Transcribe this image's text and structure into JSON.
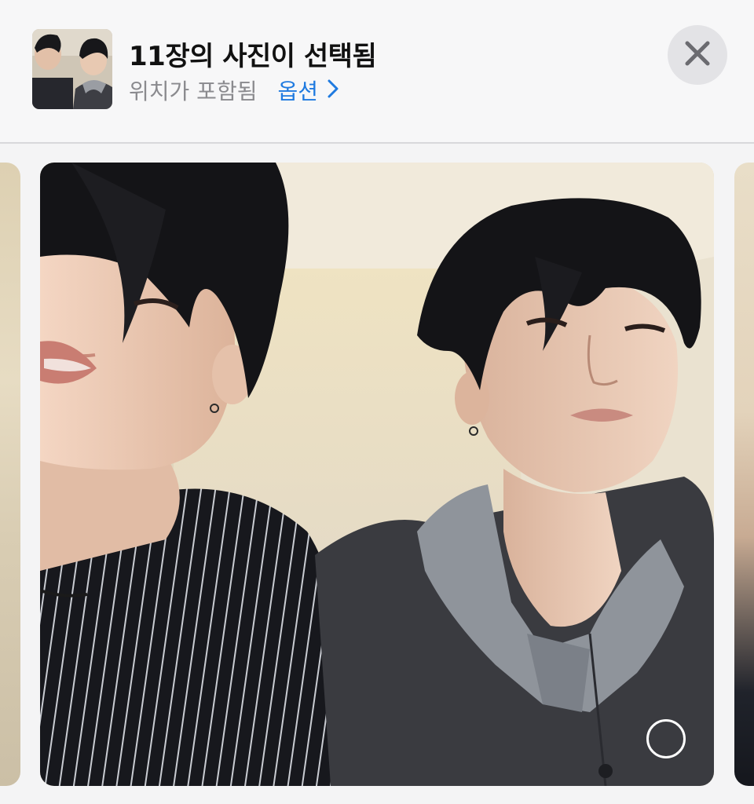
{
  "header": {
    "title": "11장의 사진이 선택됨",
    "subtitle": "위치가 포함됨",
    "options_label": "옵션",
    "thumbnail_icon": "selfie-thumbnail",
    "close_icon": "close-icon",
    "chevron_icon": "chevron-right-icon"
  },
  "colors": {
    "accent": "#1f7ae0",
    "title_text": "#111111",
    "subtitle_text": "#8a8a8e",
    "close_button_bg": "#e3e3e6"
  },
  "carousel": {
    "main_photo": "selfie-photo",
    "selection_state": "unselected"
  }
}
